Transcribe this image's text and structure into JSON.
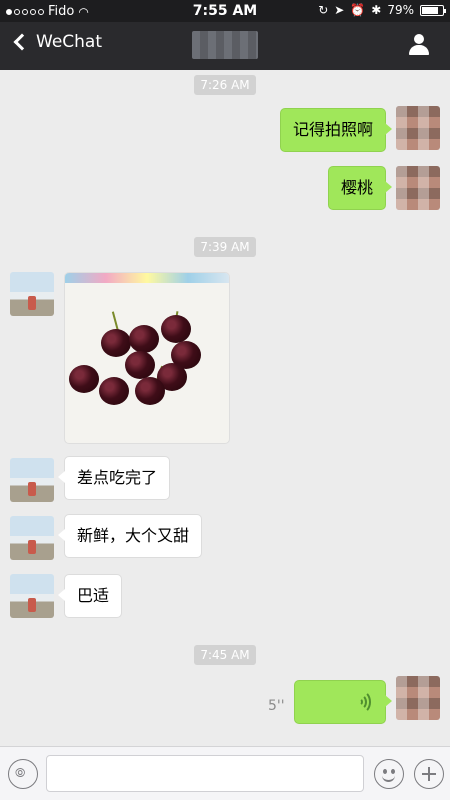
{
  "status_bar": {
    "carrier": "Fido",
    "time": "7:55 AM",
    "battery": "79%",
    "battery_level": 0.79,
    "icons": [
      "signal-dots-icon",
      "wifi-icon",
      "lock-rotation-icon",
      "location-icon",
      "alarm-icon",
      "bluetooth-icon",
      "battery-icon"
    ]
  },
  "nav": {
    "back_label": "WeChat",
    "back_icon": "chevron-left-icon",
    "title": "",
    "profile_icon": "person-icon"
  },
  "messages": [
    {
      "type": "timestamp",
      "text": "7:26 AM"
    },
    {
      "type": "text",
      "sender": "me",
      "text": "记得拍照啊"
    },
    {
      "type": "text",
      "sender": "me",
      "text": "樱桃"
    },
    {
      "type": "timestamp",
      "text": "7:39 AM"
    },
    {
      "type": "image",
      "sender": "other"
    },
    {
      "type": "text",
      "sender": "other",
      "text": "差点吃完了"
    },
    {
      "type": "text",
      "sender": "other",
      "text": "新鲜，大个又甜"
    },
    {
      "type": "text",
      "sender": "other",
      "text": "巴适"
    },
    {
      "type": "timestamp",
      "text": "7:45 AM"
    },
    {
      "type": "voice",
      "sender": "me",
      "duration": "5''"
    }
  ],
  "input_bar": {
    "text_value": "",
    "voice_icon": "voice-input-icon",
    "emoji_icon": "emoji-icon",
    "plus_icon": "plus-icon"
  },
  "colors": {
    "my_bubble": "#a0e75a",
    "other_bubble": "#ffffff",
    "nav_bg": "#2a2a2d",
    "chat_bg": "#ececec"
  }
}
